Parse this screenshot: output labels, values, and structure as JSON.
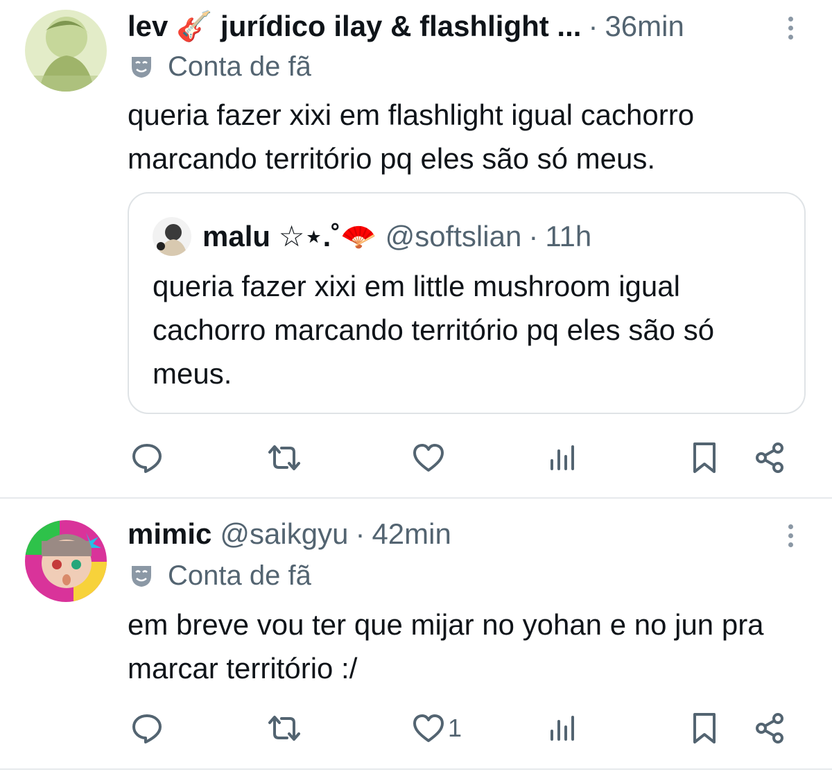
{
  "tweets": [
    {
      "name": "lev 🎸 jurídico ilay & flashlight ...",
      "handle": "",
      "dot": "·",
      "time": "36min",
      "badge": "Conta de fã",
      "text": "queria fazer xixi em flashlight igual cachorro marcando território pq eles são só meus.",
      "quote": {
        "name": "malu ☆⋆.˚🪭",
        "handle": "@softslian",
        "dot": "·",
        "time": "11h",
        "text": "queria fazer xixi em little mushroom igual cachorro marcando território pq eles são só meus."
      },
      "actions": {
        "reply": "",
        "retweet": "",
        "like": "",
        "views": ""
      }
    },
    {
      "name": "mimic",
      "handle": "@saikgyu",
      "dot": "·",
      "time": "42min",
      "badge": "Conta de fã",
      "text": "em breve vou ter que mijar no yohan e no jun pra marcar território :/",
      "actions": {
        "reply": "",
        "retweet": "",
        "like": "1",
        "views": ""
      }
    }
  ],
  "colors": {
    "text": "#0f1419",
    "secondary": "#536471",
    "border": "#e6e9ec",
    "icon": "#536471"
  },
  "icons": [
    "more-icon",
    "theater-mask-icon",
    "reply-icon",
    "retweet-icon",
    "like-icon",
    "views-icon",
    "bookmark-icon",
    "share-icon"
  ]
}
